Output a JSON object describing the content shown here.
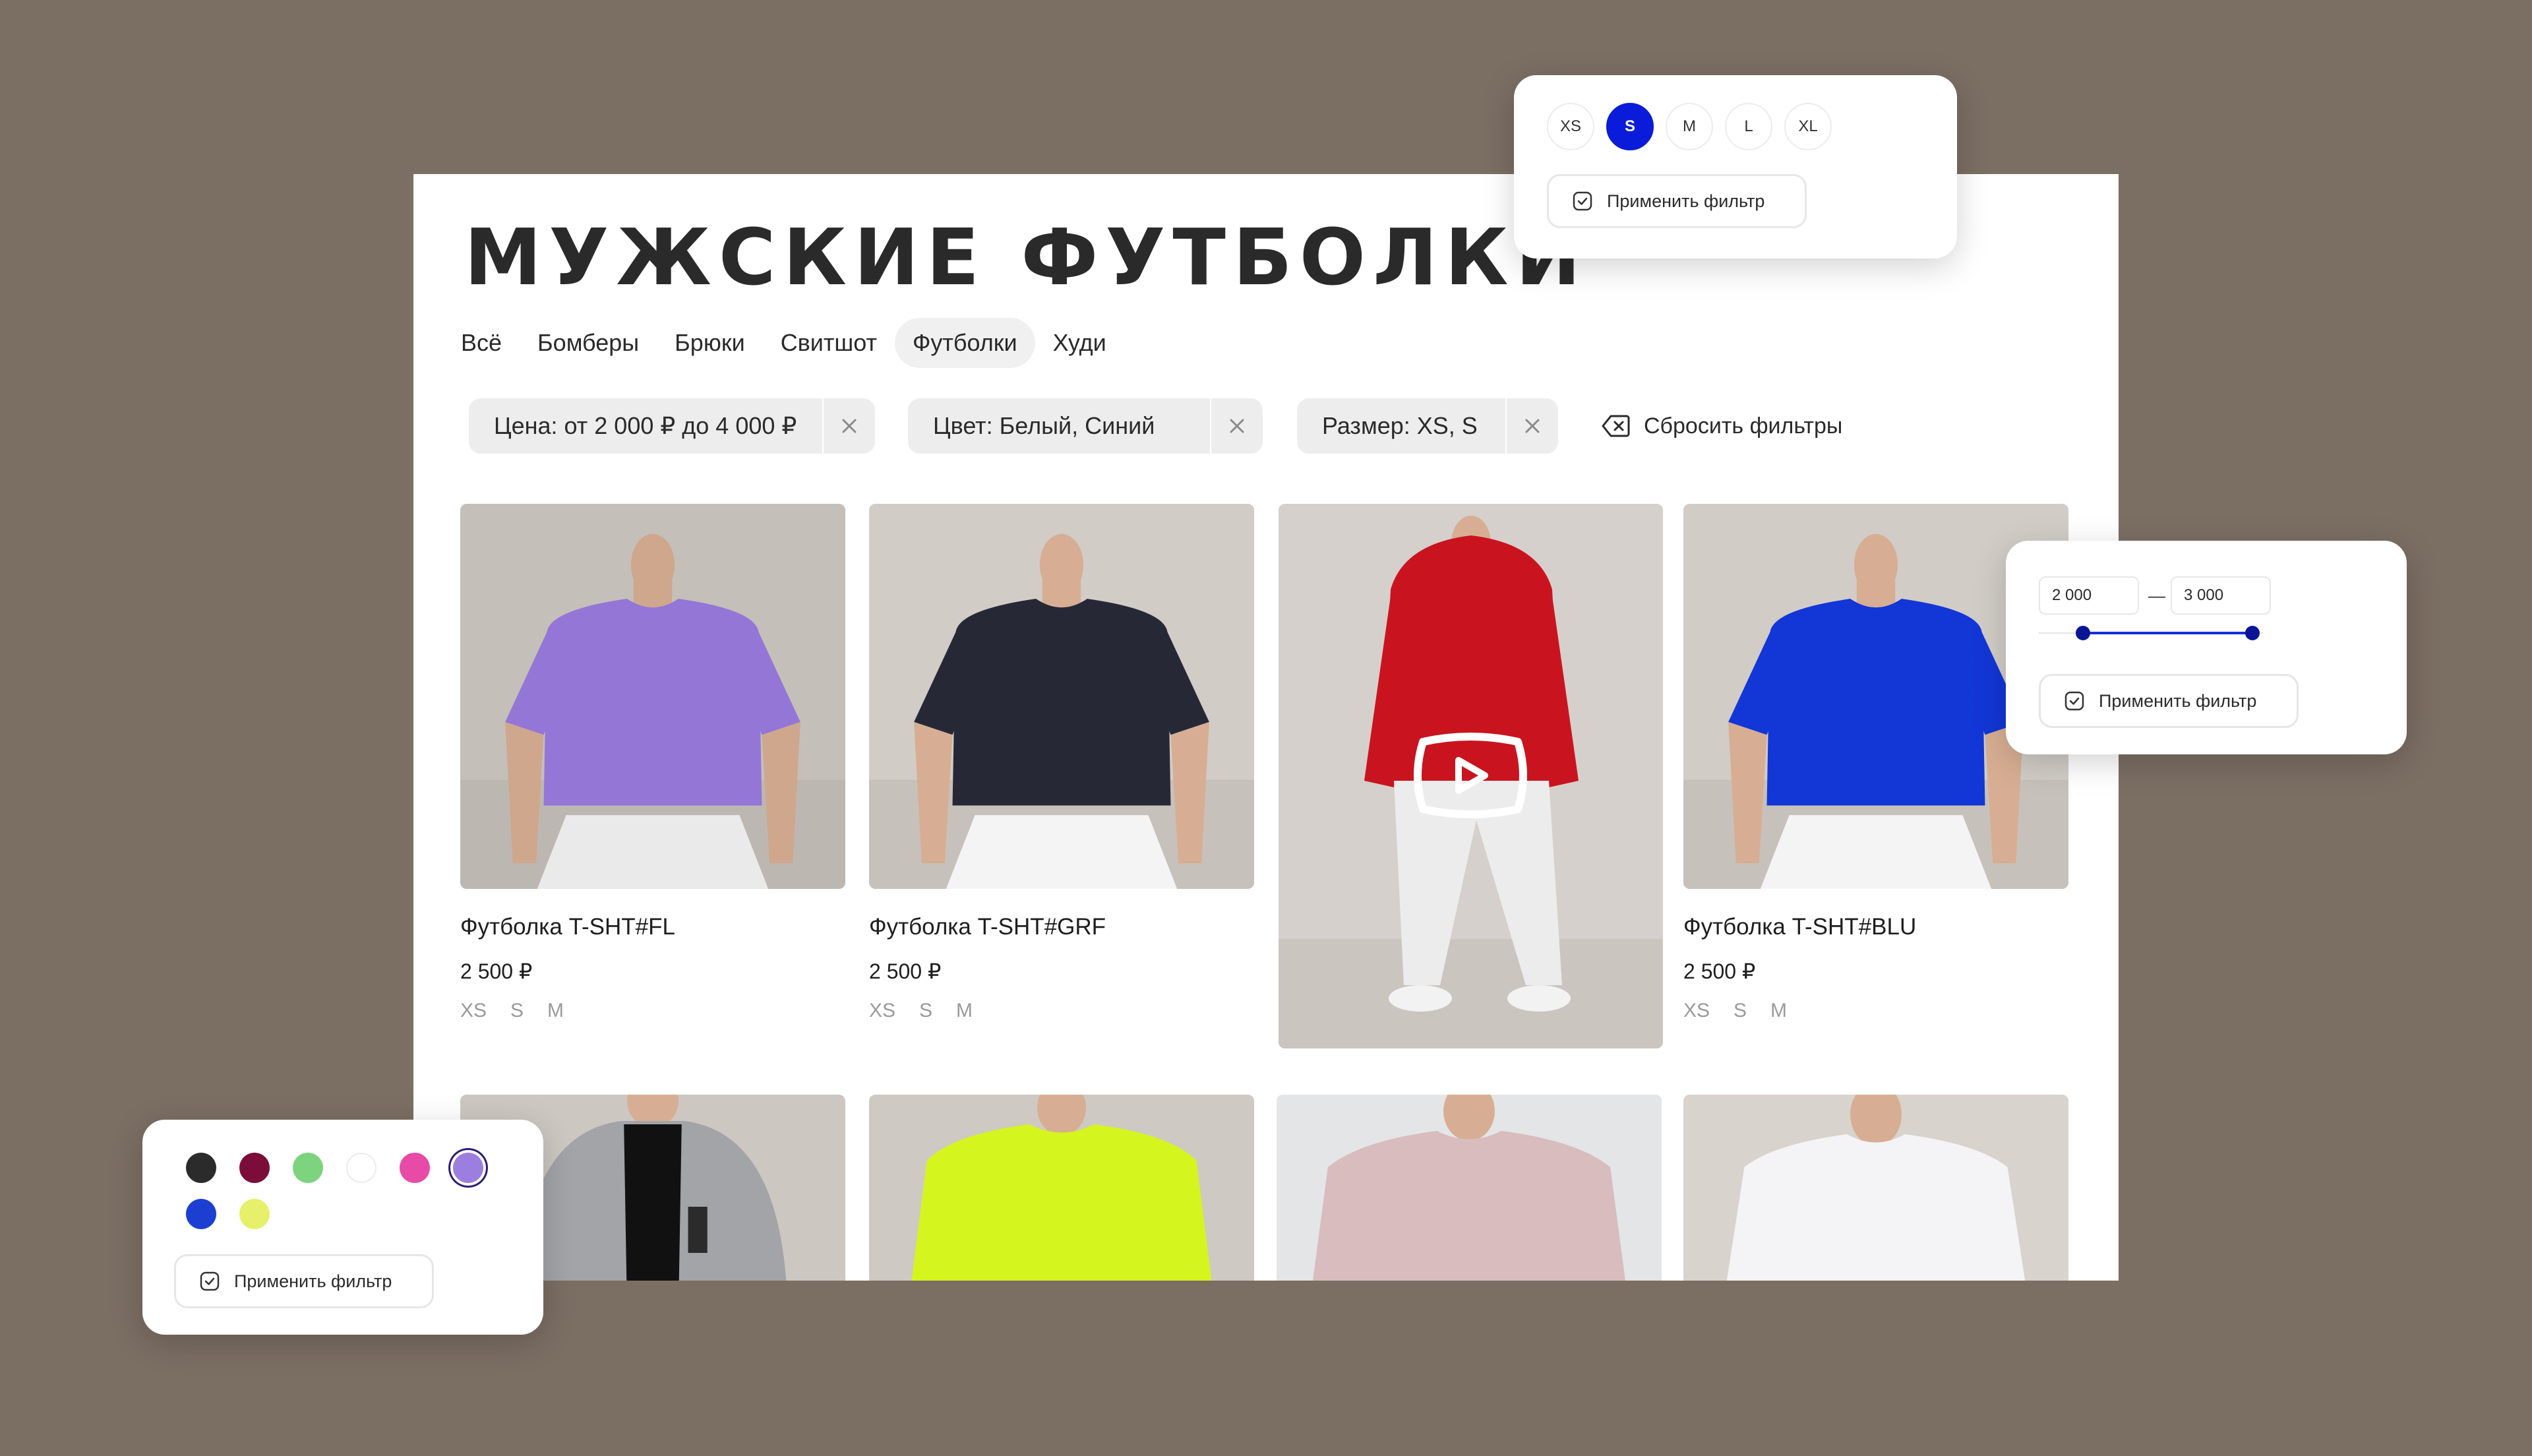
{
  "page_title": "МУЖСКИЕ ФУТБОЛКИ",
  "tabs": [
    {
      "label": "Всё"
    },
    {
      "label": "Бомберы"
    },
    {
      "label": "Брюки"
    },
    {
      "label": "Свитшот"
    },
    {
      "label": "Футболки",
      "active": true
    },
    {
      "label": "Худи"
    }
  ],
  "filters": {
    "chips": [
      {
        "label": "Цена: от 2 000 ₽ до 4 000 ₽"
      },
      {
        "label": "Цвет: Белый, Синий"
      },
      {
        "label": "Размер: XS, S"
      }
    ],
    "reset_label": "Сбросить фильтры"
  },
  "products": [
    {
      "name": "Футболка T-SHT#FL",
      "price": "2 500 ₽",
      "sizes": [
        "XS",
        "S",
        "M"
      ],
      "shirt_color": "#9b7be0"
    },
    {
      "name": "Футболка T-SHT#GRF",
      "price": "2 500 ₽",
      "sizes": [
        "XS",
        "S",
        "M"
      ],
      "shirt_color": "#262836"
    },
    {
      "video": true,
      "hoodie_color": "#c9141f",
      "play_icon": "video-play-icon"
    },
    {
      "name": "Футболка T-SHT#BLU",
      "price": "2 500 ₽",
      "sizes": [
        "XS",
        "S",
        "M"
      ],
      "shirt_color": "#1336d6"
    },
    {
      "shirt_color": "#a3a4a8"
    },
    {
      "shirt_color": "#d4f51e"
    },
    {
      "shirt_color": "#d8bcbe"
    },
    {
      "shirt_color": "#f4f4f6"
    }
  ],
  "size_popup": {
    "sizes": [
      {
        "label": "XS"
      },
      {
        "label": "S",
        "selected": true
      },
      {
        "label": "M"
      },
      {
        "label": "L"
      },
      {
        "label": "XL"
      }
    ],
    "apply_label": "Применить фильтр"
  },
  "price_popup": {
    "min": "2 000",
    "separator": "—",
    "max": "3 000",
    "apply_label": "Применить фильтр"
  },
  "color_popup": {
    "colors": [
      "#2b2b2b",
      "#7c0c3a",
      "#7ed37e",
      "#ffffff",
      "#e84aa8",
      "#9c7ee0",
      "#1c3fd1",
      "#e6f06a"
    ],
    "selected_index": 5,
    "apply_label": "Применить фильтр"
  },
  "colors": {
    "accent": "#0a1bd9",
    "background": "#7b6e63"
  }
}
